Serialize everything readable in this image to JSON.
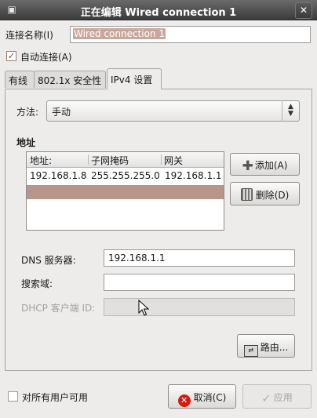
{
  "window": {
    "title": "正在编辑 Wired connection 1"
  },
  "connection": {
    "name_label": "连接名称(I)",
    "name_value": "Wired connection 1",
    "autoconnect_label": "自动连接(A)",
    "autoconnect_checked": true
  },
  "tabs": [
    {
      "label": "有线",
      "active": false
    },
    {
      "label": "802.1x 安全性",
      "active": false
    },
    {
      "label": "IPv4 设置",
      "active": true
    }
  ],
  "ipv4": {
    "method_label": "方法:",
    "method_value": "手动",
    "addresses_heading": "地址",
    "columns": [
      "地址:",
      "子网掩码",
      "网关"
    ],
    "rows": [
      [
        "192.168.1.8",
        "255.255.255.0",
        "192.168.1.1"
      ]
    ],
    "add_label": "添加(A)",
    "delete_label": "删除(D)",
    "dns_label": "DNS 服务器:",
    "dns_value": "192.168.1.1",
    "search_label": "搜索域:",
    "search_value": "",
    "dhcp_label": "DHCP 客户端 ID:",
    "dhcp_value": "",
    "routes_label": "路由..."
  },
  "footer": {
    "all_users_label": "对所有用户可用",
    "all_users_checked": false,
    "cancel_label": "取消(C)",
    "apply_label": "应用"
  }
}
